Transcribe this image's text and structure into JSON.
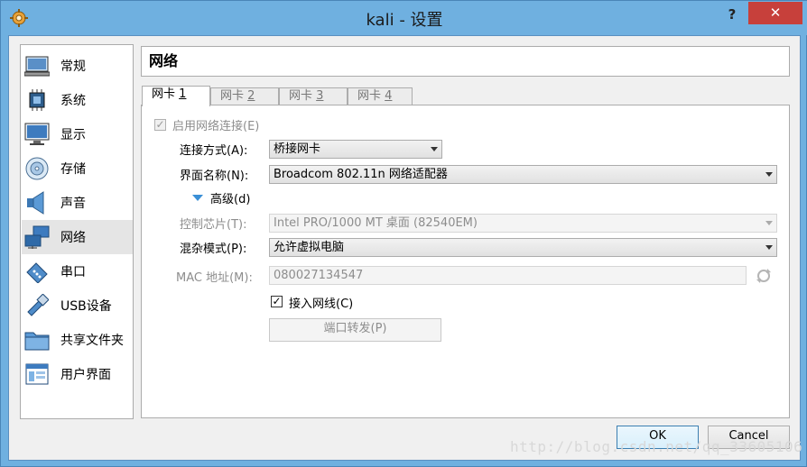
{
  "window": {
    "title": "kali - 设置",
    "help_label": "?",
    "close_label": "✕"
  },
  "sidebar": {
    "items": [
      {
        "label": "常规",
        "icon": "general-icon"
      },
      {
        "label": "系统",
        "icon": "system-icon"
      },
      {
        "label": "显示",
        "icon": "display-icon"
      },
      {
        "label": "存储",
        "icon": "storage-icon"
      },
      {
        "label": "声音",
        "icon": "audio-icon"
      },
      {
        "label": "网络",
        "icon": "network-icon",
        "selected": true
      },
      {
        "label": "串口",
        "icon": "serial-port-icon"
      },
      {
        "label": "USB设备",
        "icon": "usb-icon"
      },
      {
        "label": "共享文件夹",
        "icon": "shared-folder-icon"
      },
      {
        "label": "用户界面",
        "icon": "user-interface-icon"
      }
    ]
  },
  "page": {
    "title": "网络"
  },
  "tabs": [
    {
      "label": "网卡",
      "num": "1",
      "active": true
    },
    {
      "label": "网卡",
      "num": "2"
    },
    {
      "label": "网卡",
      "num": "3"
    },
    {
      "label": "网卡",
      "num": "4"
    }
  ],
  "adapter": {
    "enable_label": "启用网络连接(E)",
    "enabled": true,
    "attached_label": "连接方式(A):",
    "attached_value": "桥接网卡",
    "name_label": "界面名称(N):",
    "name_value": "Broadcom 802.11n 网络适配器",
    "advanced_label": "高级(d)",
    "chip_label": "控制芯片(T):",
    "chip_value": "Intel PRO/1000 MT 桌面 (82540EM)",
    "promisc_label": "混杂模式(P):",
    "promisc_value": "允许虚拟电脑",
    "mac_label": "MAC 地址(M):",
    "mac_value": "080027134547",
    "cable_label": "接入网线(C)",
    "cable_checked": true,
    "port_forward_label": "端口转发(P)"
  },
  "footer": {
    "ok_label": "OK",
    "cancel_label": "Cancel"
  },
  "watermark": "http://blog.csdn.net/qq_33605106",
  "colors": {
    "titlebar": "#6fb0e0",
    "close": "#c7403b",
    "selected_item": "#e5e5e5",
    "accent": "#3c7fb1"
  }
}
